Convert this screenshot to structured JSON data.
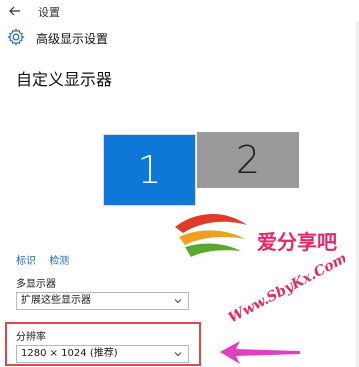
{
  "window": {
    "title": "设置"
  },
  "header": {
    "title": "高级显示设置"
  },
  "page": {
    "title": "自定义显示器"
  },
  "monitors": [
    {
      "label": "1",
      "selected": true
    },
    {
      "label": "2",
      "selected": false
    }
  ],
  "links": {
    "identify": "标识",
    "detect": "检测"
  },
  "multi_display": {
    "label": "多显示器",
    "value": "扩展这些显示器"
  },
  "resolution": {
    "label": "分辨率",
    "value": "1280 × 1024 (推荐)"
  },
  "watermark": {
    "text_cn": "爱分享吧",
    "text_url": "Www.SbyKx.Com"
  },
  "colors": {
    "accent": "#0f77d7",
    "monitor_inactive": "#999999",
    "link": "#1468c6",
    "highlight": "#e04848",
    "arrow": "#e040c0"
  },
  "icons": {
    "back": "back-arrow-icon",
    "settings": "gear-icon",
    "dropdown": "chevron-down-icon"
  }
}
